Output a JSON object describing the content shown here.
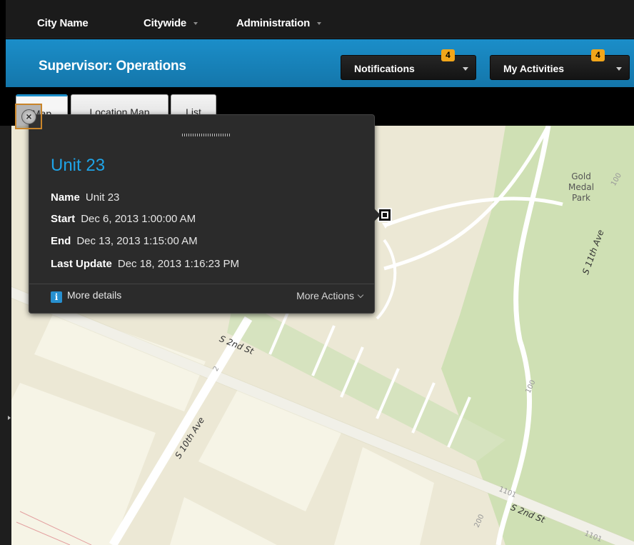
{
  "nav": {
    "items": [
      {
        "label": "City Name"
      },
      {
        "label": "Citywide"
      },
      {
        "label": "Administration"
      }
    ]
  },
  "header": {
    "title": "Supervisor: Operations",
    "notifications_label": "Notifications",
    "notifications_count": "4",
    "activities_label": "My Activities",
    "activities_count": "4"
  },
  "tabs": [
    {
      "label": "Map"
    },
    {
      "label": "Location Map"
    },
    {
      "label": "List"
    }
  ],
  "popup": {
    "title": "Unit 23",
    "fields": [
      {
        "label": "Name",
        "value": "Unit 23"
      },
      {
        "label": "Start",
        "value": "Dec 6, 2013 1:00:00 AM"
      },
      {
        "label": "End",
        "value": "Dec 13, 2013 1:15:00 AM"
      },
      {
        "label": "Last Update",
        "value": "Dec 18, 2013 1:16:23 PM"
      }
    ],
    "more_details": "More details",
    "more_actions": "More Actions"
  },
  "map": {
    "labels": {
      "park": "Gold\nMedal\nPark",
      "street_2nd_upper": "S 2nd St",
      "street_2nd_lower": "S 2nd St",
      "street_11th": "S 11th Ave",
      "street_10th": "S 10th Ave",
      "num_100a": "100",
      "num_100b": "100",
      "num_200": "200",
      "num_1101a": "1101",
      "num_1101b": "1101",
      "num_2": "2"
    }
  },
  "colors": {
    "accent": "#1b8ec9",
    "badge": "#f2a61a",
    "link": "#1fa3e6",
    "park": "#cfe0b4",
    "land": "#ece8d5",
    "block": "#f6f4e6"
  }
}
